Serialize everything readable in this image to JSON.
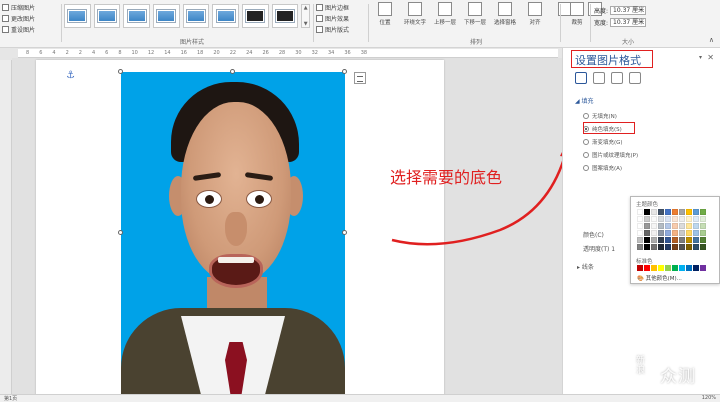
{
  "ribbon": {
    "left_cmds": [
      "压缩图片",
      "更改图片",
      "重设图片"
    ],
    "effects_cmds": [
      "图片边框",
      "图片效果",
      "图片版式"
    ],
    "picture_styles_label": "图片样式",
    "arrange_label": "排列",
    "size_label": "大小",
    "arrange_buttons": [
      "位置",
      "环绕文字",
      "上移一层",
      "下移一层",
      "选择窗格",
      "对齐"
    ],
    "crop_label": "裁剪",
    "height_label": "高度:",
    "height_value": "10.37 厘米",
    "width_label": "宽度:",
    "width_value": "10.37 厘米"
  },
  "ruler_ticks": [
    "8",
    "6",
    "4",
    "2",
    "2",
    "4",
    "6",
    "8",
    "10",
    "12",
    "14",
    "16",
    "18",
    "20",
    "22",
    "24",
    "26",
    "28",
    "30",
    "32",
    "34",
    "36",
    "38"
  ],
  "annotation": {
    "text": "选择需要的底色"
  },
  "pane": {
    "title": "设置图片格式",
    "fill_section": "填充",
    "fill_options": [
      "无填充(N)",
      "纯色填充(S)",
      "渐变填充(G)",
      "图片或纹理填充(P)",
      "图案填充(A)"
    ],
    "selected_fill": "纯色填充(S)",
    "color_label": "颜色(C)",
    "transparency_label": "透明度(T)",
    "transparency_value": "1",
    "line_section": "线条"
  },
  "color_menu": {
    "theme_label": "主题颜色",
    "standard_label": "标准色",
    "more_colors": "其他颜色(M)...",
    "theme_colors": [
      "#ffffff",
      "#000000",
      "#e7e6e6",
      "#44546a",
      "#4472c4",
      "#ed7d31",
      "#a5a5a5",
      "#ffc000",
      "#5b9bd5",
      "#70ad47"
    ],
    "standard_colors": [
      "#c00000",
      "#ff0000",
      "#ffc000",
      "#ffff00",
      "#92d050",
      "#00b050",
      "#00b0f0",
      "#0070c0",
      "#002060",
      "#7030a0"
    ]
  },
  "status": {
    "left": "第1页",
    "right": "120%"
  },
  "watermark": {
    "brand": "值 什么值得买",
    "text": "新浪众测"
  }
}
